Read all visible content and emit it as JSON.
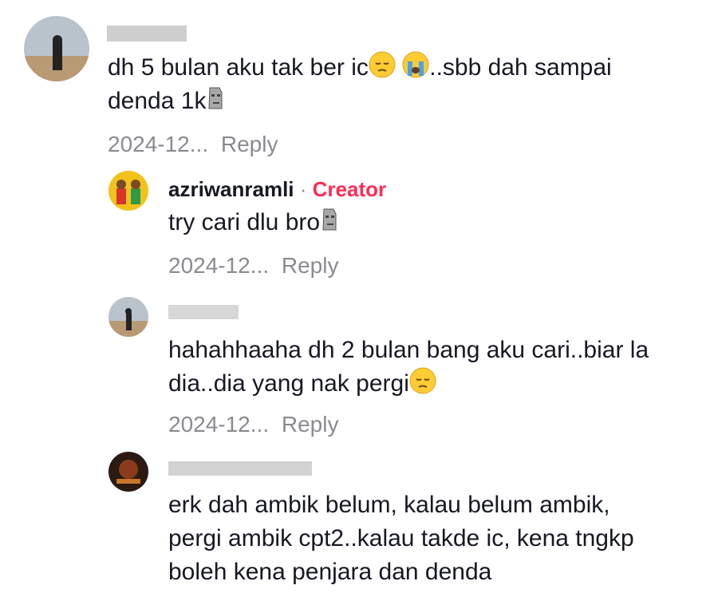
{
  "comments": [
    {
      "username": "",
      "text_line1": "dh 5 bulan aku tak ber ic",
      "text_line1_suffix": "..sbb dah sampai",
      "text_line2": "denda 1k",
      "date": "2024-12...",
      "reply_label": "Reply"
    },
    {
      "username": "azriwanramli",
      "separator": "·",
      "badge": "Creator",
      "text_line1": "try cari dlu bro",
      "date": "2024-12...",
      "reply_label": "Reply"
    },
    {
      "username": "",
      "text_line1": "hahahhaaha dh 2 bulan bang aku cari..biar la",
      "text_line2": "dia..dia yang nak pergi",
      "date": "2024-12...",
      "reply_label": "Reply"
    },
    {
      "username": "",
      "text_line1": "erk dah ambik belum, kalau belum ambik,",
      "text_line2": "pergi ambik cpt2..kalau takde ic, kena tngkp",
      "text_line3": "boleh kena penjara dan denda"
    }
  ],
  "colors": {
    "text": "#161823",
    "secondary": "#8a8b91",
    "creator_badge": "#fe2c55",
    "redaction": "#cfcfcf"
  },
  "icons": [
    "pensive-face-emoji",
    "loudly-crying-face-emoji",
    "moai-emoji"
  ]
}
